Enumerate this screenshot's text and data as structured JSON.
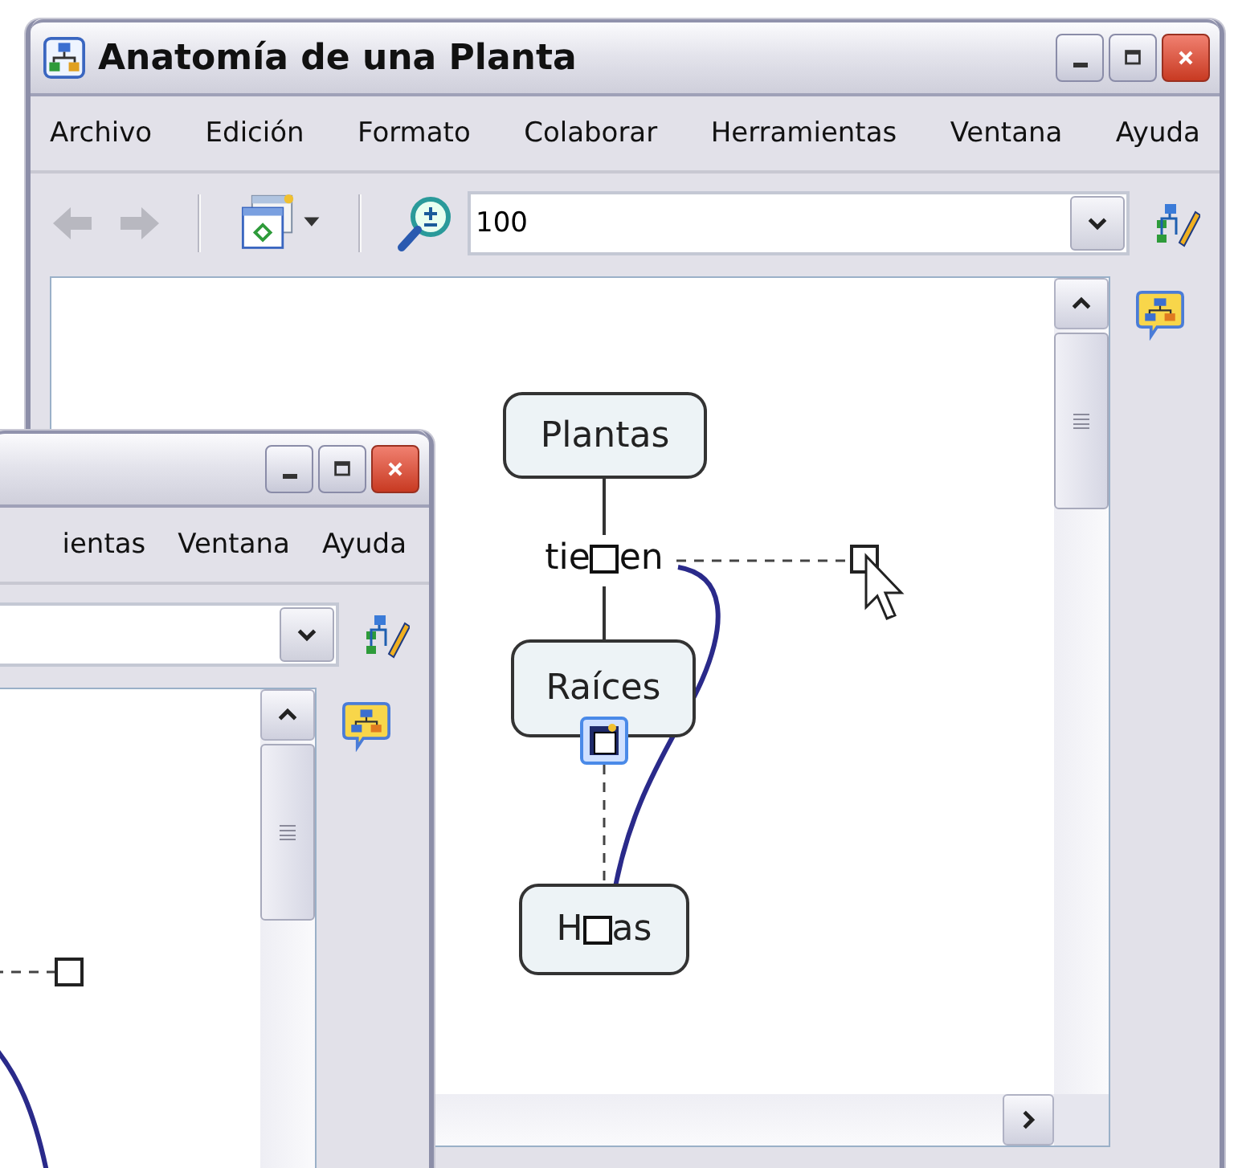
{
  "back_window": {
    "title": "Anatomía de una Planta",
    "menu": [
      "Archivo",
      "Edición",
      "Formato",
      "Colaborar",
      "Herramientas",
      "Ventana",
      "Ayuda"
    ],
    "toolbar": {
      "back": {
        "disabled": true
      },
      "forward": {
        "disabled": true
      },
      "zoom_field": {
        "value": "100"
      }
    },
    "concept_map": {
      "concepts": [
        {
          "parts": [
            "Plantas"
          ]
        },
        {
          "parts": [
            "Raíces"
          ]
        },
        {
          "parts": [
            "H",
            "as"
          ]
        }
      ],
      "linking_phrase": {
        "parts": [
          "tie",
          "en"
        ]
      }
    }
  },
  "front_window": {
    "menu": [
      "ientas",
      "Ventana",
      "Ayuda"
    ]
  }
}
